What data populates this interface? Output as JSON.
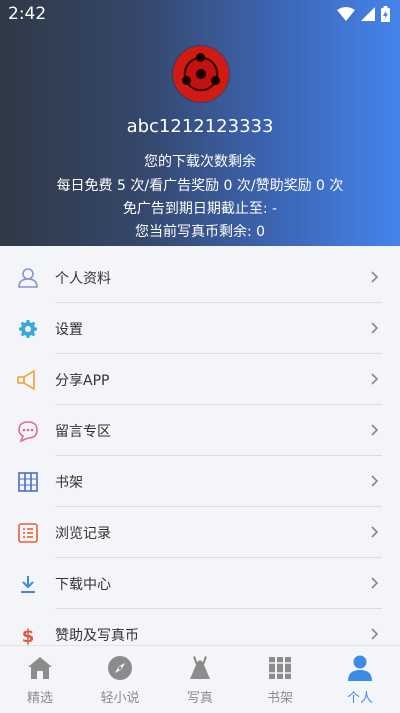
{
  "status_bar": {
    "time": "2:42"
  },
  "profile": {
    "username": "abc1212123333",
    "download_title": "您的下载次数剩余",
    "download_detail": "每日免费 5 次/看广告奖励 0 次/赞助奖励 0 次",
    "ad_free_until": "免广告到期日期截止至: -",
    "coins": "您当前写真币剩余: 0"
  },
  "menu": [
    {
      "label": "个人资料",
      "icon": "user-icon"
    },
    {
      "label": "设置",
      "icon": "gear-icon"
    },
    {
      "label": "分享APP",
      "icon": "megaphone-icon"
    },
    {
      "label": "留言专区",
      "icon": "chat-icon"
    },
    {
      "label": "书架",
      "icon": "bookshelf-icon"
    },
    {
      "label": "浏览记录",
      "icon": "history-list-icon"
    },
    {
      "label": "下载中心",
      "icon": "download-icon"
    },
    {
      "label": "赞助及写真币",
      "icon": "dollar-icon"
    }
  ],
  "tabs": [
    {
      "label": "精选",
      "icon": "house-icon"
    },
    {
      "label": "轻小说",
      "icon": "compass-icon"
    },
    {
      "label": "写真",
      "icon": "dress-icon"
    },
    {
      "label": "书架",
      "icon": "books-icon"
    },
    {
      "label": "个人",
      "icon": "person-icon",
      "active": true
    }
  ],
  "colors": {
    "accent": "#3c8ce7",
    "header_start": "#2f3947",
    "header_end": "#4484ea"
  }
}
